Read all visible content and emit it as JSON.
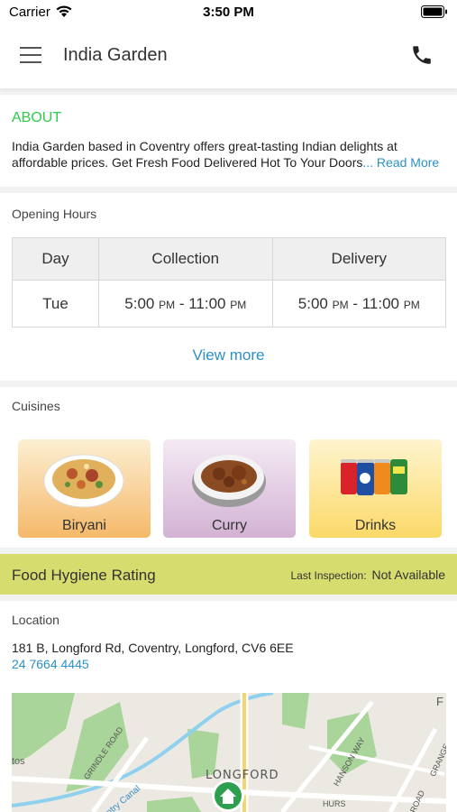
{
  "status_bar": {
    "carrier": "Carrier",
    "time": "3:50 PM"
  },
  "nav": {
    "title": "India Garden",
    "menu_icon": "hamburger-menu-icon",
    "phone_icon": "phone-icon"
  },
  "about": {
    "heading": "ABOUT",
    "text": "India Garden based in Coventry offers great-tasting Indian delights at affordable prices. Get Fresh Food Delivered Hot To Your Doors",
    "read_more": "... Read More"
  },
  "opening_hours": {
    "label": "Opening Hours",
    "headers": {
      "day": "Day",
      "collection": "Collection",
      "delivery": "Delivery"
    },
    "rows": [
      {
        "day": "Tue",
        "collection": {
          "open": "5:00",
          "open_suffix": "PM",
          "sep": " - ",
          "close": "11:00",
          "close_suffix": "PM"
        },
        "delivery": {
          "open": "5:00",
          "open_suffix": "PM",
          "sep": " - ",
          "close": "11:00",
          "close_suffix": "PM"
        }
      }
    ],
    "view_more": "View more"
  },
  "cuisines": {
    "label": "Cuisines",
    "items": [
      {
        "name": "Biryani",
        "icon": "biryani-plate-icon"
      },
      {
        "name": "Curry",
        "icon": "curry-bowl-icon"
      },
      {
        "name": "Drinks",
        "icon": "soda-cans-icon"
      }
    ]
  },
  "hygiene": {
    "title": "Food Hygiene Rating",
    "inspection_label": "Last Inspection:",
    "inspection_value": "Not Available"
  },
  "location": {
    "label": "Location",
    "address": "181 B, Longford Rd, Coventry, Longford, CV6 6EE",
    "phone": "24 7664 4445",
    "map": {
      "area_label": "LONGFORD",
      "labels": [
        "tos",
        "GRINDLE ROAD",
        "ntry Canal",
        "HANSON WAY",
        "ROAD",
        "GRANGE",
        "HURS",
        "F"
      ],
      "marker_icon": "home-marker-icon"
    }
  },
  "colors": {
    "accent_green": "#2ecc4b",
    "link_blue": "#2b91c7",
    "hygiene_bar": "#d6dc6e"
  }
}
